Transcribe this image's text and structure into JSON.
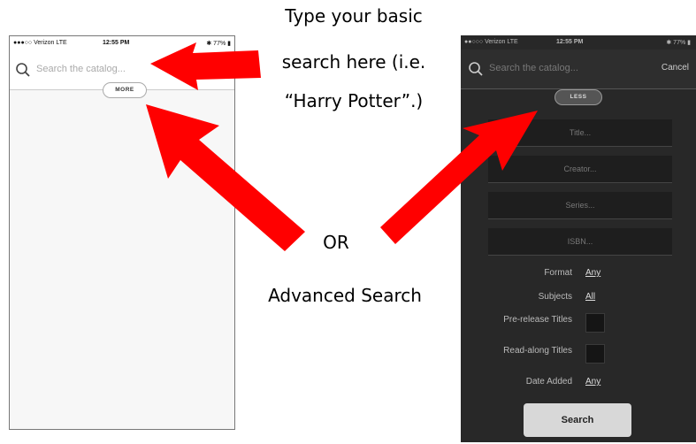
{
  "left_phone": {
    "status": {
      "carrier": "●●●○○ Verizon  LTE",
      "time": "12:55 PM",
      "battery": "✱ 77% ▮"
    },
    "search": {
      "placeholder": "Search the catalog..."
    },
    "more_label": "MORE"
  },
  "right_phone": {
    "status": {
      "carrier": "●●○○○ Verizon  LTE",
      "time": "12:55 PM",
      "battery": "✱ 77% ▮"
    },
    "search": {
      "placeholder": "Search the catalog...",
      "cancel_label": "Cancel"
    },
    "less_label": "LESS",
    "fields": [
      "Title...",
      "Creator...",
      "Series...",
      "ISBN..."
    ],
    "format": {
      "label": "Format",
      "value": "Any"
    },
    "subjects": {
      "label": "Subjects",
      "value": "All"
    },
    "prerelease_label": "Pre-release Titles",
    "readalong_label": "Read-along Titles",
    "date_added": {
      "label": "Date Added",
      "value": "Any"
    },
    "search_button_label": "Search"
  },
  "annotations": {
    "basic_line1": "Type your basic",
    "basic_line2": "search here (i.e.",
    "basic_line3": "“Harry Potter”.)",
    "or": "OR",
    "advanced": "Advanced Search"
  },
  "colors": {
    "arrow": "#ff0000",
    "dark_bg": "#282828"
  }
}
